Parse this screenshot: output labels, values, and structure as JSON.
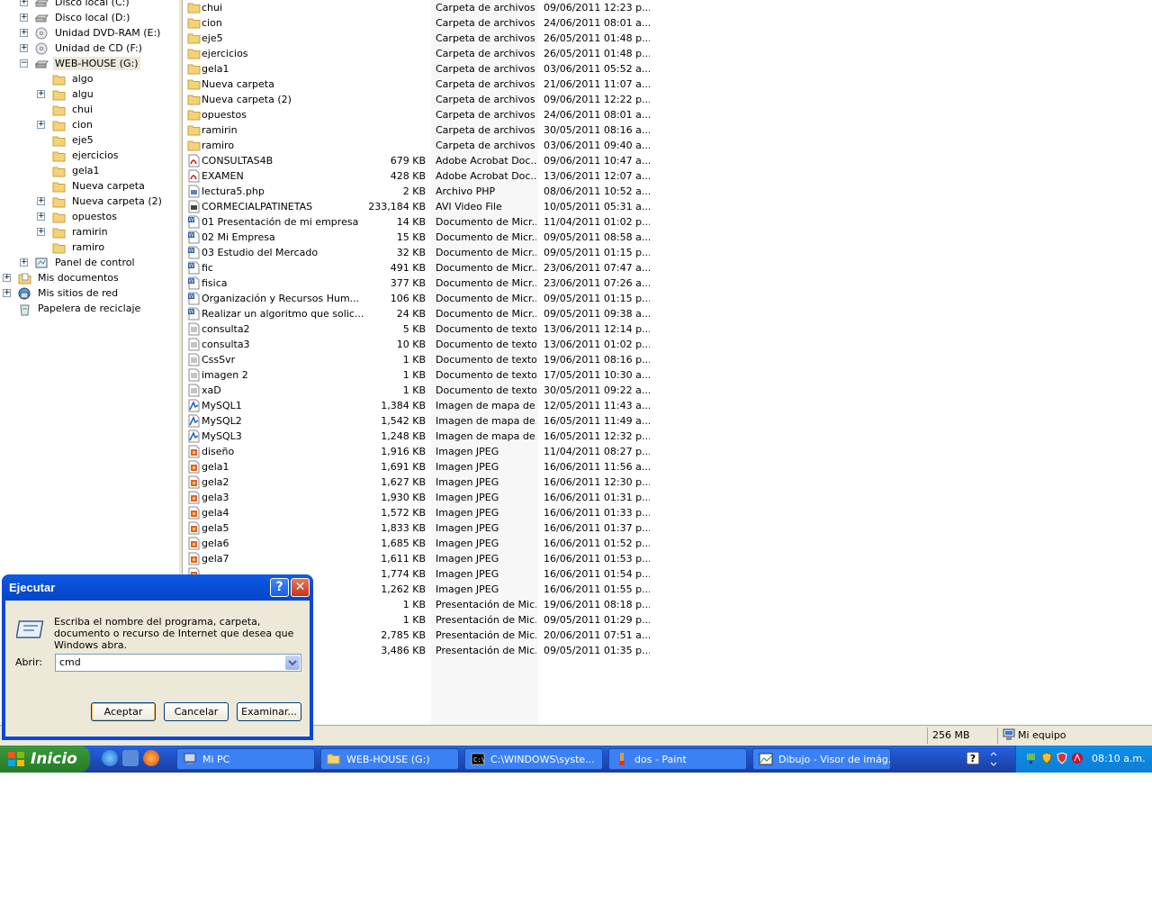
{
  "tree": {
    "items": [
      {
        "label": "Disco local (C:)",
        "icon": "hard-drive-icon",
        "level": 1,
        "expander": "+"
      },
      {
        "label": "Disco local (D:)",
        "icon": "hard-drive-icon",
        "level": 1,
        "expander": "+"
      },
      {
        "label": "Unidad DVD-RAM (E:)",
        "icon": "dvd-drive-icon",
        "level": 1,
        "expander": "+"
      },
      {
        "label": "Unidad de CD (F:)",
        "icon": "cd-drive-icon",
        "level": 1,
        "expander": "+"
      },
      {
        "label": "WEB-HOUSE (G:)",
        "icon": "removable-drive-icon",
        "level": 1,
        "expander": "−",
        "selected": true
      },
      {
        "label": "algo",
        "icon": "folder-icon",
        "level": 2,
        "expander": ""
      },
      {
        "label": "algu",
        "icon": "folder-icon",
        "level": 2,
        "expander": "+"
      },
      {
        "label": "chui",
        "icon": "folder-icon",
        "level": 2,
        "expander": ""
      },
      {
        "label": "cion",
        "icon": "folder-icon",
        "level": 2,
        "expander": "+"
      },
      {
        "label": "eje5",
        "icon": "folder-icon",
        "level": 2,
        "expander": ""
      },
      {
        "label": "ejercicios",
        "icon": "folder-icon",
        "level": 2,
        "expander": ""
      },
      {
        "label": "gela1",
        "icon": "folder-icon",
        "level": 2,
        "expander": ""
      },
      {
        "label": "Nueva carpeta",
        "icon": "folder-icon",
        "level": 2,
        "expander": ""
      },
      {
        "label": "Nueva carpeta (2)",
        "icon": "folder-icon",
        "level": 2,
        "expander": "+"
      },
      {
        "label": "opuestos",
        "icon": "folder-icon",
        "level": 2,
        "expander": "+"
      },
      {
        "label": "ramirin",
        "icon": "folder-icon",
        "level": 2,
        "expander": "+"
      },
      {
        "label": "ramiro",
        "icon": "folder-icon",
        "level": 2,
        "expander": ""
      },
      {
        "label": "Panel de control",
        "icon": "control-panel-icon",
        "level": 1,
        "expander": "+"
      },
      {
        "label": "Mis documentos",
        "icon": "my-documents-icon",
        "level": 0,
        "expander": "+"
      },
      {
        "label": "Mis sitios de red",
        "icon": "network-places-icon",
        "level": 0,
        "expander": "+"
      },
      {
        "label": "Papelera de reciclaje",
        "icon": "recycle-bin-icon",
        "level": 0,
        "expander": ""
      }
    ]
  },
  "files": [
    {
      "name": "chui",
      "size": "",
      "type": "Carpeta de archivos",
      "date": "09/06/2011 12:23 p...",
      "icon": "folder-icon"
    },
    {
      "name": "cion",
      "size": "",
      "type": "Carpeta de archivos",
      "date": "24/06/2011 08:01 a...",
      "icon": "folder-icon"
    },
    {
      "name": "eje5",
      "size": "",
      "type": "Carpeta de archivos",
      "date": "26/05/2011 01:48 p...",
      "icon": "folder-icon"
    },
    {
      "name": "ejercicios",
      "size": "",
      "type": "Carpeta de archivos",
      "date": "26/05/2011 01:48 p...",
      "icon": "folder-icon"
    },
    {
      "name": "gela1",
      "size": "",
      "type": "Carpeta de archivos",
      "date": "03/06/2011 05:52 a...",
      "icon": "folder-icon"
    },
    {
      "name": "Nueva carpeta",
      "size": "",
      "type": "Carpeta de archivos",
      "date": "21/06/2011 11:07 a...",
      "icon": "folder-icon"
    },
    {
      "name": "Nueva carpeta (2)",
      "size": "",
      "type": "Carpeta de archivos",
      "date": "09/06/2011 12:22 p...",
      "icon": "folder-icon"
    },
    {
      "name": "opuestos",
      "size": "",
      "type": "Carpeta de archivos",
      "date": "24/06/2011 08:01 a...",
      "icon": "folder-icon"
    },
    {
      "name": "ramirin",
      "size": "",
      "type": "Carpeta de archivos",
      "date": "30/05/2011 08:16 a...",
      "icon": "folder-icon"
    },
    {
      "name": "ramiro",
      "size": "",
      "type": "Carpeta de archivos",
      "date": "03/06/2011 09:40 a...",
      "icon": "folder-icon"
    },
    {
      "name": "CONSULTAS4B",
      "size": "679 KB",
      "type": "Adobe Acrobat Doc...",
      "date": "09/06/2011 10:47 a...",
      "icon": "pdf-file-icon"
    },
    {
      "name": "EXAMEN",
      "size": "428 KB",
      "type": "Adobe Acrobat Doc...",
      "date": "13/06/2011 12:07 a...",
      "icon": "pdf-file-icon"
    },
    {
      "name": "lectura5.php",
      "size": "2 KB",
      "type": "Archivo PHP",
      "date": "08/06/2011 10:52 a...",
      "icon": "php-file-icon"
    },
    {
      "name": "CORMECIALPATINETAS",
      "size": "233,184 KB",
      "type": "AVI Video File",
      "date": "10/05/2011 05:31 a...",
      "icon": "video-file-icon"
    },
    {
      "name": "01 Presentación de mi empresa",
      "size": "14 KB",
      "type": "Documento de Micr...",
      "date": "11/04/2011 01:02 p...",
      "icon": "word-file-icon"
    },
    {
      "name": "02 Mi Empresa",
      "size": "15 KB",
      "type": "Documento de Micr...",
      "date": "09/05/2011 08:58 a...",
      "icon": "word-file-icon"
    },
    {
      "name": "03 Estudio del Mercado",
      "size": "32 KB",
      "type": "Documento de Micr...",
      "date": "09/05/2011 01:15 p...",
      "icon": "word-file-icon"
    },
    {
      "name": "fic",
      "size": "491 KB",
      "type": "Documento de Micr...",
      "date": "23/06/2011 07:47 a...",
      "icon": "word-file-icon"
    },
    {
      "name": "fisica",
      "size": "377 KB",
      "type": "Documento de Micr...",
      "date": "23/06/2011 07:26 a...",
      "icon": "word-file-icon"
    },
    {
      "name": "Organización y Recursos Hum...",
      "size": "106 KB",
      "type": "Documento de Micr...",
      "date": "09/05/2011 01:15 p...",
      "icon": "word-file-icon"
    },
    {
      "name": "Realizar un algoritmo que solic...",
      "size": "24 KB",
      "type": "Documento de Micr...",
      "date": "09/05/2011 09:38 a...",
      "icon": "word-file-icon"
    },
    {
      "name": "consulta2",
      "size": "5 KB",
      "type": "Documento de texto",
      "date": "13/06/2011 12:14 p...",
      "icon": "text-file-icon"
    },
    {
      "name": "consulta3",
      "size": "10 KB",
      "type": "Documento de texto",
      "date": "13/06/2011 01:02 p...",
      "icon": "text-file-icon"
    },
    {
      "name": "CssSvr",
      "size": "1 KB",
      "type": "Documento de texto",
      "date": "19/06/2011 08:16 p...",
      "icon": "text-file-icon"
    },
    {
      "name": "imagen 2",
      "size": "1 KB",
      "type": "Documento de texto",
      "date": "17/05/2011 10:30 a...",
      "icon": "text-file-icon"
    },
    {
      "name": "xaD",
      "size": "1 KB",
      "type": "Documento de texto",
      "date": "30/05/2011 09:22 a...",
      "icon": "text-file-icon"
    },
    {
      "name": "MySQL1",
      "size": "1,384 KB",
      "type": "Imagen de mapa de...",
      "date": "12/05/2011 11:43 a...",
      "icon": "bitmap-file-icon"
    },
    {
      "name": "MySQL2",
      "size": "1,542 KB",
      "type": "Imagen de mapa de...",
      "date": "16/05/2011 11:49 a...",
      "icon": "bitmap-file-icon"
    },
    {
      "name": "MySQL3",
      "size": "1,248 KB",
      "type": "Imagen de mapa de...",
      "date": "16/05/2011 12:32 p...",
      "icon": "bitmap-file-icon"
    },
    {
      "name": "diseño",
      "size": "1,916 KB",
      "type": "Imagen JPEG",
      "date": "11/04/2011 08:27 p...",
      "icon": "jpeg-file-icon"
    },
    {
      "name": "gela1",
      "size": "1,691 KB",
      "type": "Imagen JPEG",
      "date": "16/06/2011 11:56 a...",
      "icon": "jpeg-file-icon"
    },
    {
      "name": "gela2",
      "size": "1,627 KB",
      "type": "Imagen JPEG",
      "date": "16/06/2011 12:30 p...",
      "icon": "jpeg-file-icon"
    },
    {
      "name": "gela3",
      "size": "1,930 KB",
      "type": "Imagen JPEG",
      "date": "16/06/2011 01:31 p...",
      "icon": "jpeg-file-icon"
    },
    {
      "name": "gela4",
      "size": "1,572 KB",
      "type": "Imagen JPEG",
      "date": "16/06/2011 01:33 p...",
      "icon": "jpeg-file-icon"
    },
    {
      "name": "gela5",
      "size": "1,833 KB",
      "type": "Imagen JPEG",
      "date": "16/06/2011 01:37 p...",
      "icon": "jpeg-file-icon"
    },
    {
      "name": "gela6",
      "size": "1,685 KB",
      "type": "Imagen JPEG",
      "date": "16/06/2011 01:52 p...",
      "icon": "jpeg-file-icon"
    },
    {
      "name": "gela7",
      "size": "1,611 KB",
      "type": "Imagen JPEG",
      "date": "16/06/2011 01:53 p...",
      "icon": "jpeg-file-icon"
    },
    {
      "name": "",
      "size": "1,774 KB",
      "type": "Imagen JPEG",
      "date": "16/06/2011 01:54 p...",
      "icon": "jpeg-file-icon"
    },
    {
      "name": "",
      "size": "1,262 KB",
      "type": "Imagen JPEG",
      "date": "16/06/2011 01:55 p...",
      "icon": ""
    },
    {
      "name": "",
      "size": "1 KB",
      "type": "Presentación de Mic...",
      "date": "19/06/2011 08:18 p...",
      "icon": ""
    },
    {
      "name": "",
      "size": "1 KB",
      "type": "Presentación de Mic...",
      "date": "09/05/2011 01:29 p...",
      "icon": ""
    },
    {
      "name": "",
      "size": "2,785 KB",
      "type": "Presentación de Mic...",
      "date": "20/06/2011 07:51 a...",
      "icon": ""
    },
    {
      "name": "",
      "size": "3,486 KB",
      "type": "Presentación de Mic...",
      "date": "09/05/2011 01:35 p...",
      "icon": ""
    }
  ],
  "statusbar": {
    "size": "256 MB",
    "location": "Mi equipo"
  },
  "run_dialog": {
    "title": "Ejecutar",
    "description": "Escriba el nombre del programa, carpeta, documento o recurso de Internet que desea que Windows abra.",
    "open_label": "Abrir:",
    "open_value": "cmd",
    "ok_label": "Aceptar",
    "cancel_label": "Cancelar",
    "browse_label": "Examinar...",
    "help_glyph": "?",
    "close_glyph": "✕"
  },
  "taskbar": {
    "start_label": "Inicio",
    "tasks": [
      {
        "label": "Mi PC",
        "icon": "my-computer-icon"
      },
      {
        "label": "WEB-HOUSE (G:)",
        "icon": "folder-icon"
      },
      {
        "label": "C:\\WINDOWS\\syste...",
        "icon": "command-prompt-icon"
      },
      {
        "label": "dos - Paint",
        "icon": "paint-icon"
      },
      {
        "label": "Dibujo - Visor de imág...",
        "icon": "image-viewer-icon"
      }
    ],
    "clock": "08:10 a.m."
  },
  "colors": {
    "taskbar": "#245edb",
    "start": "#2f8b2f",
    "title_bar": "#0a4fd8",
    "dialog_body": "#ece9d8",
    "folder": "#f3d27a"
  }
}
